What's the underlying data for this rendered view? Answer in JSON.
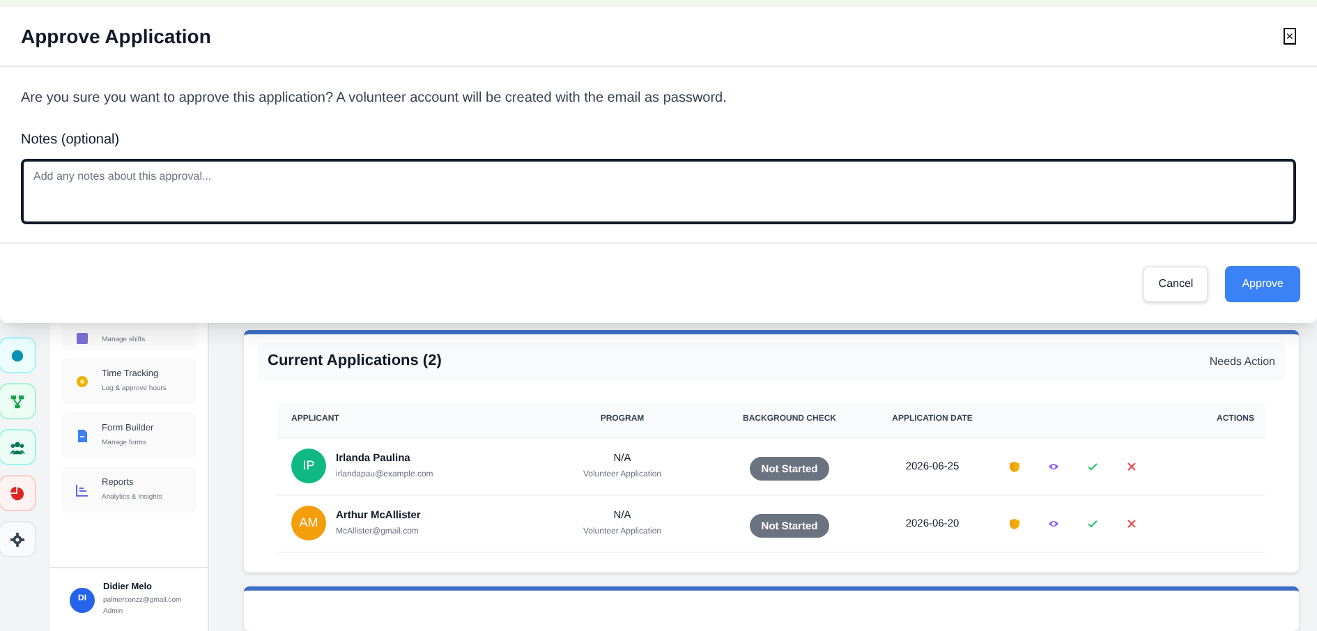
{
  "modal": {
    "title": "Approve Application",
    "close": "×",
    "message": "Are you sure you want to approve this application? A volunteer account will be created with the email as password.",
    "notes_label": "Notes (optional)",
    "notes_placeholder": "Add any notes about this approval...",
    "buttons": [
      {
        "label": "Cancel",
        "kind": "secondary"
      },
      {
        "label": "Approve",
        "kind": "primary"
      }
    ]
  },
  "rail": [
    {
      "kind": "dot",
      "color": "#0891b2"
    },
    {
      "kind": "tree",
      "color": "#16a34a"
    },
    {
      "kind": "people",
      "color": "#047857"
    },
    {
      "kind": "pie",
      "color": "#dc2626"
    },
    {
      "kind": "gear",
      "color": "#374151"
    }
  ],
  "nav": [
    {
      "kind": "calendar",
      "subtitle": "Manage shifts"
    },
    {
      "kind": "clock",
      "title": "Time Tracking",
      "subtitle": "Log & approve hours"
    },
    {
      "kind": "file",
      "title": "Form Builder",
      "subtitle": "Manage forms"
    },
    {
      "kind": "chart",
      "title": "Reports",
      "subtitle": "Analytics & Insights"
    }
  ],
  "user": {
    "initials": "DI",
    "name": "Didier Melo",
    "email": "palmerconzz@gmail.com",
    "role": "Admin"
  },
  "applications": {
    "title": "Current Applications (2)",
    "status": "Needs Action",
    "columns": [
      "APPLICANT",
      "PROGRAM",
      "BACKGROUND CHECK",
      "APPLICATION DATE",
      "ACTIONS"
    ],
    "rows": [
      {
        "initials": "IP",
        "color": "#10b981",
        "name": "Irlanda Paulina",
        "email": "irlandapau@example.com",
        "program": "N/A",
        "program_type": "Volunteer Application",
        "check": "Not Started",
        "date": "2026-06-25"
      },
      {
        "initials": "AM",
        "color": "#f59e0b",
        "name": "Arthur McAllister",
        "email": "McAllister@gmail.com",
        "program": "N/A",
        "program_type": "Volunteer Application",
        "check": "Not Started",
        "date": "2026-06-20"
      }
    ]
  }
}
